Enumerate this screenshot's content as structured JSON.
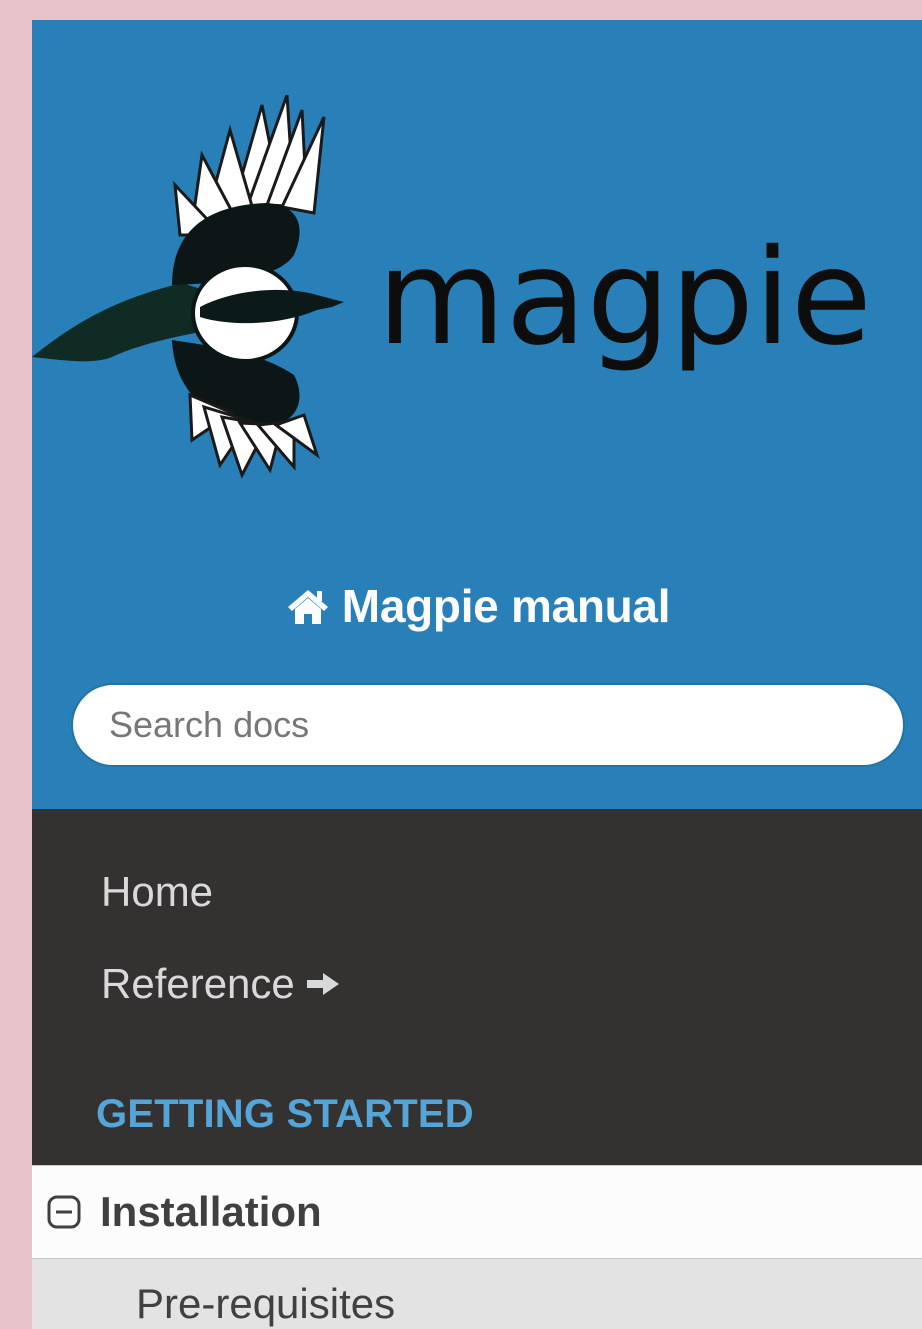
{
  "brand": {
    "logo_text": "magpie",
    "home_icon": "home-icon",
    "home_label": "Magpie manual"
  },
  "search": {
    "placeholder": "Search docs"
  },
  "nav": {
    "items": [
      {
        "label": "Home"
      },
      {
        "label": "Reference",
        "icon": "arrow-right-icon"
      }
    ],
    "caption": "GETTING STARTED",
    "current": {
      "label": "Installation",
      "icon": "collapse-toggle-icon"
    },
    "subitems": [
      {
        "label": "Pre-requisites"
      }
    ]
  },
  "colors": {
    "header_blue": "#2980b9",
    "sidebar_dark": "#343131",
    "caption_blue": "#55a5d9",
    "page_pink": "#e9c3cc",
    "current_bg": "#fcfcfc",
    "subitem_bg": "#e3e3e3"
  }
}
